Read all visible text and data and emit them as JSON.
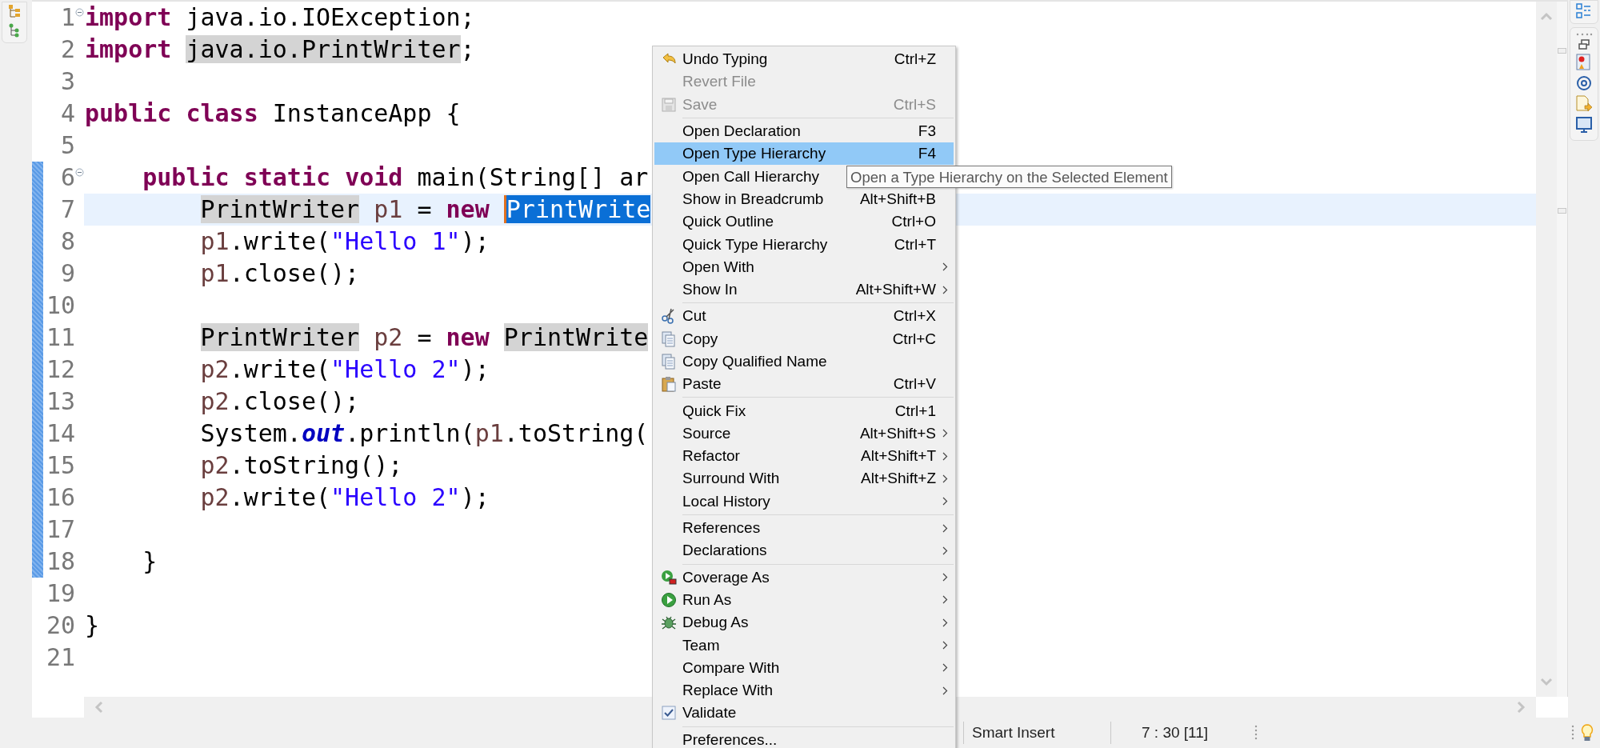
{
  "editor": {
    "lines": [
      {
        "number": "1",
        "fold": true,
        "changed": false,
        "current": false,
        "tokens": [
          {
            "text": "import",
            "kind": "kw"
          },
          {
            "text": " java.io.IOException;",
            "kind": "txt"
          }
        ]
      },
      {
        "number": "2",
        "fold": false,
        "changed": false,
        "current": false,
        "tokens": [
          {
            "text": "import",
            "kind": "kw"
          },
          {
            "text": " java.io.PrintWriter",
            "kind": "occ"
          },
          {
            "text": ";",
            "kind": "txt"
          }
        ]
      },
      {
        "number": "3",
        "fold": false,
        "changed": false,
        "current": false
      },
      {
        "number": "4",
        "fold": false,
        "changed": false,
        "current": false,
        "tokens": [
          {
            "text": "public",
            "kind": "kw"
          },
          {
            "text": " class",
            "kind": "kw"
          },
          {
            "text": " InstanceApp {",
            "kind": "txt"
          }
        ]
      },
      {
        "number": "5",
        "fold": false,
        "changed": false,
        "current": false
      },
      {
        "number": "6",
        "fold": true,
        "changed": true,
        "current": false,
        "tokens": [
          {
            "text": "    public",
            "kind": "kw"
          },
          {
            "text": " static",
            "kind": "kw"
          },
          {
            "text": " void",
            "kind": "kw"
          },
          {
            "text": " main(String[] ar",
            "kind": "txt"
          }
        ]
      },
      {
        "number": "7",
        "fold": false,
        "changed": true,
        "current": true,
        "tokens": [
          {
            "text": "        PrintWriter",
            "kind": "occ"
          },
          {
            "text": " p1",
            "kind": "var"
          },
          {
            "text": " = ",
            "kind": "txt"
          },
          {
            "text": "new",
            "kind": "kw"
          },
          {
            "text": " PrintWrite",
            "kind": "sel"
          }
        ]
      },
      {
        "number": "8",
        "fold": false,
        "changed": true,
        "current": false,
        "tokens": [
          {
            "text": "        p1",
            "kind": "var"
          },
          {
            "text": ".write(",
            "kind": "txt"
          },
          {
            "text": "\"Hello 1\"",
            "kind": "str"
          },
          {
            "text": ");",
            "kind": "txt"
          }
        ]
      },
      {
        "number": "9",
        "fold": false,
        "changed": true,
        "current": false,
        "tokens": [
          {
            "text": "        p1",
            "kind": "var"
          },
          {
            "text": ".close();",
            "kind": "txt"
          }
        ]
      },
      {
        "number": "10",
        "fold": false,
        "changed": true,
        "current": false
      },
      {
        "number": "11",
        "fold": false,
        "changed": true,
        "current": false,
        "tokens": [
          {
            "text": "        PrintWriter",
            "kind": "occ"
          },
          {
            "text": " p2",
            "kind": "var"
          },
          {
            "text": " = ",
            "kind": "txt"
          },
          {
            "text": "new",
            "kind": "kw"
          },
          {
            "text": " PrintWrite",
            "kind": "occ"
          }
        ]
      },
      {
        "number": "12",
        "fold": false,
        "changed": true,
        "current": false,
        "tokens": [
          {
            "text": "        p2",
            "kind": "var"
          },
          {
            "text": ".write(",
            "kind": "txt"
          },
          {
            "text": "\"Hello 2\"",
            "kind": "str"
          },
          {
            "text": ");",
            "kind": "txt"
          }
        ]
      },
      {
        "number": "13",
        "fold": false,
        "changed": true,
        "current": false,
        "tokens": [
          {
            "text": "        p2",
            "kind": "var"
          },
          {
            "text": ".close();",
            "kind": "txt"
          }
        ]
      },
      {
        "number": "14",
        "fold": false,
        "changed": true,
        "current": false,
        "tokens": [
          {
            "text": "        System.",
            "kind": "txt"
          },
          {
            "text": "out",
            "kind": "field"
          },
          {
            "text": ".println(",
            "kind": "txt"
          },
          {
            "text": "p1",
            "kind": "var"
          },
          {
            "text": ".toString(",
            "kind": "txt"
          }
        ]
      },
      {
        "number": "15",
        "fold": false,
        "changed": true,
        "current": false,
        "tokens": [
          {
            "text": "        p2",
            "kind": "var"
          },
          {
            "text": ".toString();",
            "kind": "txt"
          }
        ]
      },
      {
        "number": "16",
        "fold": false,
        "changed": true,
        "current": false,
        "tokens": [
          {
            "text": "        p2",
            "kind": "var"
          },
          {
            "text": ".write(",
            "kind": "txt"
          },
          {
            "text": "\"Hello 2\"",
            "kind": "str"
          },
          {
            "text": ");",
            "kind": "txt"
          }
        ]
      },
      {
        "number": "17",
        "fold": false,
        "changed": true,
        "current": false
      },
      {
        "number": "18",
        "fold": false,
        "changed": true,
        "current": false,
        "tokens": [
          {
            "text": "    }",
            "kind": "txt"
          }
        ]
      },
      {
        "number": "19",
        "fold": false,
        "changed": false,
        "current": false
      },
      {
        "number": "20",
        "fold": false,
        "changed": false,
        "current": false,
        "tokens": [
          {
            "text": "}",
            "kind": "txt"
          }
        ]
      },
      {
        "number": "21",
        "fold": false,
        "changed": false,
        "current": false
      }
    ]
  },
  "context_menu": {
    "groups": [
      [
        {
          "label": "Undo Typing",
          "shortcut": "Ctrl+Z",
          "submenu": false,
          "disabled": false,
          "selected": false,
          "checked": false
        },
        {
          "label": "Revert File",
          "submenu": false,
          "disabled": true,
          "selected": false,
          "checked": false
        },
        {
          "label": "Save",
          "shortcut": "Ctrl+S",
          "submenu": false,
          "disabled": true,
          "selected": false,
          "checked": false
        }
      ],
      [
        {
          "label": "Open Declaration",
          "shortcut": "F3",
          "submenu": false,
          "disabled": false,
          "selected": false,
          "checked": false
        },
        {
          "label": "Open Type Hierarchy",
          "shortcut": "F4",
          "submenu": false,
          "disabled": false,
          "selected": true,
          "checked": false
        },
        {
          "label": "Open Call Hierarchy",
          "submenu": false,
          "disabled": false,
          "selected": false,
          "checked": false
        },
        {
          "label": "Show in Breadcrumb",
          "shortcut": "Alt+Shift+B",
          "submenu": false,
          "disabled": false,
          "selected": false,
          "checked": false
        },
        {
          "label": "Quick Outline",
          "shortcut": "Ctrl+O",
          "submenu": false,
          "disabled": false,
          "selected": false,
          "checked": false
        },
        {
          "label": "Quick Type Hierarchy",
          "shortcut": "Ctrl+T",
          "submenu": false,
          "disabled": false,
          "selected": false,
          "checked": false
        },
        {
          "label": "Open With",
          "submenu": true,
          "disabled": false,
          "selected": false,
          "checked": false
        },
        {
          "label": "Show In",
          "shortcut": "Alt+Shift+W",
          "submenu": true,
          "disabled": false,
          "selected": false,
          "checked": false
        }
      ],
      [
        {
          "label": "Cut",
          "shortcut": "Ctrl+X",
          "submenu": false,
          "disabled": false,
          "selected": false,
          "checked": false
        },
        {
          "label": "Copy",
          "shortcut": "Ctrl+C",
          "submenu": false,
          "disabled": false,
          "selected": false,
          "checked": false
        },
        {
          "label": "Copy Qualified Name",
          "submenu": false,
          "disabled": false,
          "selected": false,
          "checked": false
        },
        {
          "label": "Paste",
          "shortcut": "Ctrl+V",
          "submenu": false,
          "disabled": false,
          "selected": false,
          "checked": false
        }
      ],
      [
        {
          "label": "Quick Fix",
          "shortcut": "Ctrl+1",
          "submenu": false,
          "disabled": false,
          "selected": false,
          "checked": false
        },
        {
          "label": "Source",
          "shortcut": "Alt+Shift+S",
          "submenu": true,
          "disabled": false,
          "selected": false,
          "checked": false
        },
        {
          "label": "Refactor",
          "shortcut": "Alt+Shift+T",
          "submenu": true,
          "disabled": false,
          "selected": false,
          "checked": false
        },
        {
          "label": "Surround With",
          "shortcut": "Alt+Shift+Z",
          "submenu": true,
          "disabled": false,
          "selected": false,
          "checked": false
        },
        {
          "label": "Local History",
          "submenu": true,
          "disabled": false,
          "selected": false,
          "checked": false
        }
      ],
      [
        {
          "label": "References",
          "submenu": true,
          "disabled": false,
          "selected": false,
          "checked": false
        },
        {
          "label": "Declarations",
          "submenu": true,
          "disabled": false,
          "selected": false,
          "checked": false
        }
      ],
      [
        {
          "label": "Coverage As",
          "submenu": true,
          "disabled": false,
          "selected": false,
          "checked": false
        },
        {
          "label": "Run As",
          "submenu": true,
          "disabled": false,
          "selected": false,
          "checked": false
        },
        {
          "label": "Debug As",
          "submenu": true,
          "disabled": false,
          "selected": false,
          "checked": false
        },
        {
          "label": "Team",
          "submenu": true,
          "disabled": false,
          "selected": false,
          "checked": false
        },
        {
          "label": "Compare With",
          "submenu": true,
          "disabled": false,
          "selected": false,
          "checked": false
        },
        {
          "label": "Replace With",
          "submenu": true,
          "disabled": false,
          "selected": false,
          "checked": false
        },
        {
          "label": "Validate",
          "submenu": false,
          "disabled": false,
          "selected": false,
          "checked": true
        }
      ],
      [
        {
          "label": "Preferences...",
          "submenu": false,
          "disabled": false,
          "selected": false,
          "checked": false
        }
      ]
    ]
  },
  "tooltip": {
    "text": "Open a Type Hierarchy on the Selected Element"
  },
  "status_bar": {
    "insert_mode": "Smart Insert",
    "cursor_position": "7 : 30 [11]"
  }
}
